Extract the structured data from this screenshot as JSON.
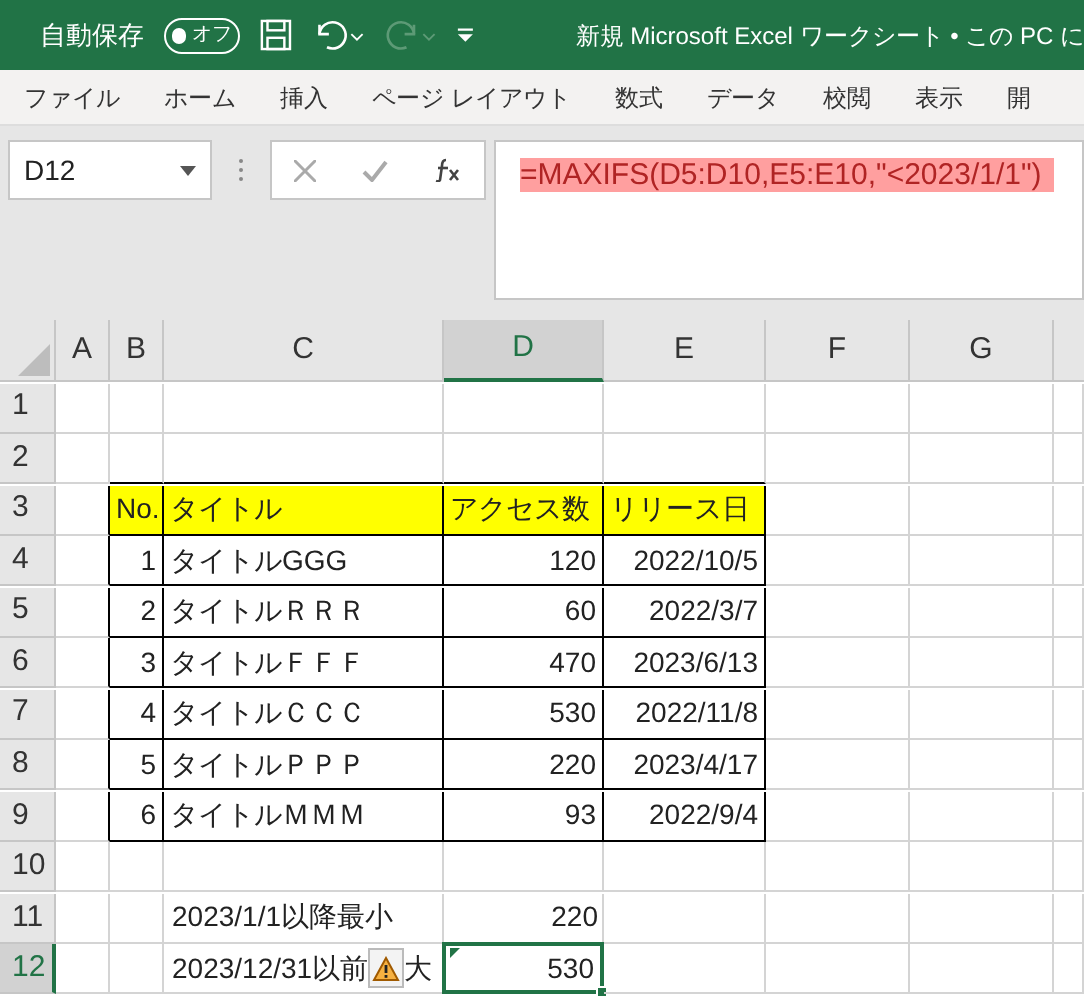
{
  "title_bar": {
    "autosave_label": "自動保存",
    "autosave_toggle": {
      "label": "オフ",
      "on": false
    },
    "title": "新規 Microsoft Excel ワークシート • この PC に"
  },
  "ribbon_tabs": [
    {
      "label": "ファイル",
      "selected": false
    },
    {
      "label": "ホーム",
      "selected": false
    },
    {
      "label": "挿入",
      "selected": false
    },
    {
      "label": "ページ レイアウト",
      "selected": false
    },
    {
      "label": "数式",
      "selected": false
    },
    {
      "label": "データ",
      "selected": false
    },
    {
      "label": "校閲",
      "selected": false
    },
    {
      "label": "表示",
      "selected": false
    },
    {
      "label": "開",
      "selected": false
    }
  ],
  "name_box": "D12",
  "formula": "=MAXIFS(D5:D10,E5:E10,\"<2023/1/1\")",
  "columns": [
    {
      "label": "A",
      "selected": false
    },
    {
      "label": "B",
      "selected": false
    },
    {
      "label": "C",
      "selected": false
    },
    {
      "label": "D",
      "selected": true
    },
    {
      "label": "E",
      "selected": false
    },
    {
      "label": "F",
      "selected": false
    },
    {
      "label": "G",
      "selected": false
    }
  ],
  "row_headers": [
    {
      "label": "1",
      "selected": false
    },
    {
      "label": "2",
      "selected": false
    },
    {
      "label": "3",
      "selected": false
    },
    {
      "label": "4",
      "selected": false
    },
    {
      "label": "5",
      "selected": false
    },
    {
      "label": "6",
      "selected": false
    },
    {
      "label": "7",
      "selected": false
    },
    {
      "label": "8",
      "selected": false
    },
    {
      "label": "9",
      "selected": false
    },
    {
      "label": "10",
      "selected": false
    },
    {
      "label": "11",
      "selected": false
    },
    {
      "label": "12",
      "selected": true
    }
  ],
  "table": {
    "header": [
      "No.",
      "タイトル",
      "アクセス数",
      "リリース日"
    ],
    "rows": [
      [
        "1",
        "タイトルGGG",
        "120",
        "2022/10/5"
      ],
      [
        "2",
        "タイトルＲＲＲ",
        "60",
        "2022/3/7"
      ],
      [
        "3",
        "タイトルＦＦＦ",
        "470",
        "2023/6/13"
      ],
      [
        "4",
        "タイトルＣＣＣ",
        "530",
        "2022/11/8"
      ],
      [
        "5",
        "タイトルＰＰＰ",
        "220",
        "2023/4/17"
      ],
      [
        "6",
        "タイトルＭＭＭ",
        "93",
        "2022/9/4"
      ]
    ]
  },
  "summary": [
    {
      "label": "2023/1/1以降最小",
      "value": "220",
      "selected": false,
      "warning": false
    },
    {
      "label": "2023/12/31以前",
      "label_after": "大",
      "value": "530",
      "selected": true,
      "warning": true
    }
  ]
}
